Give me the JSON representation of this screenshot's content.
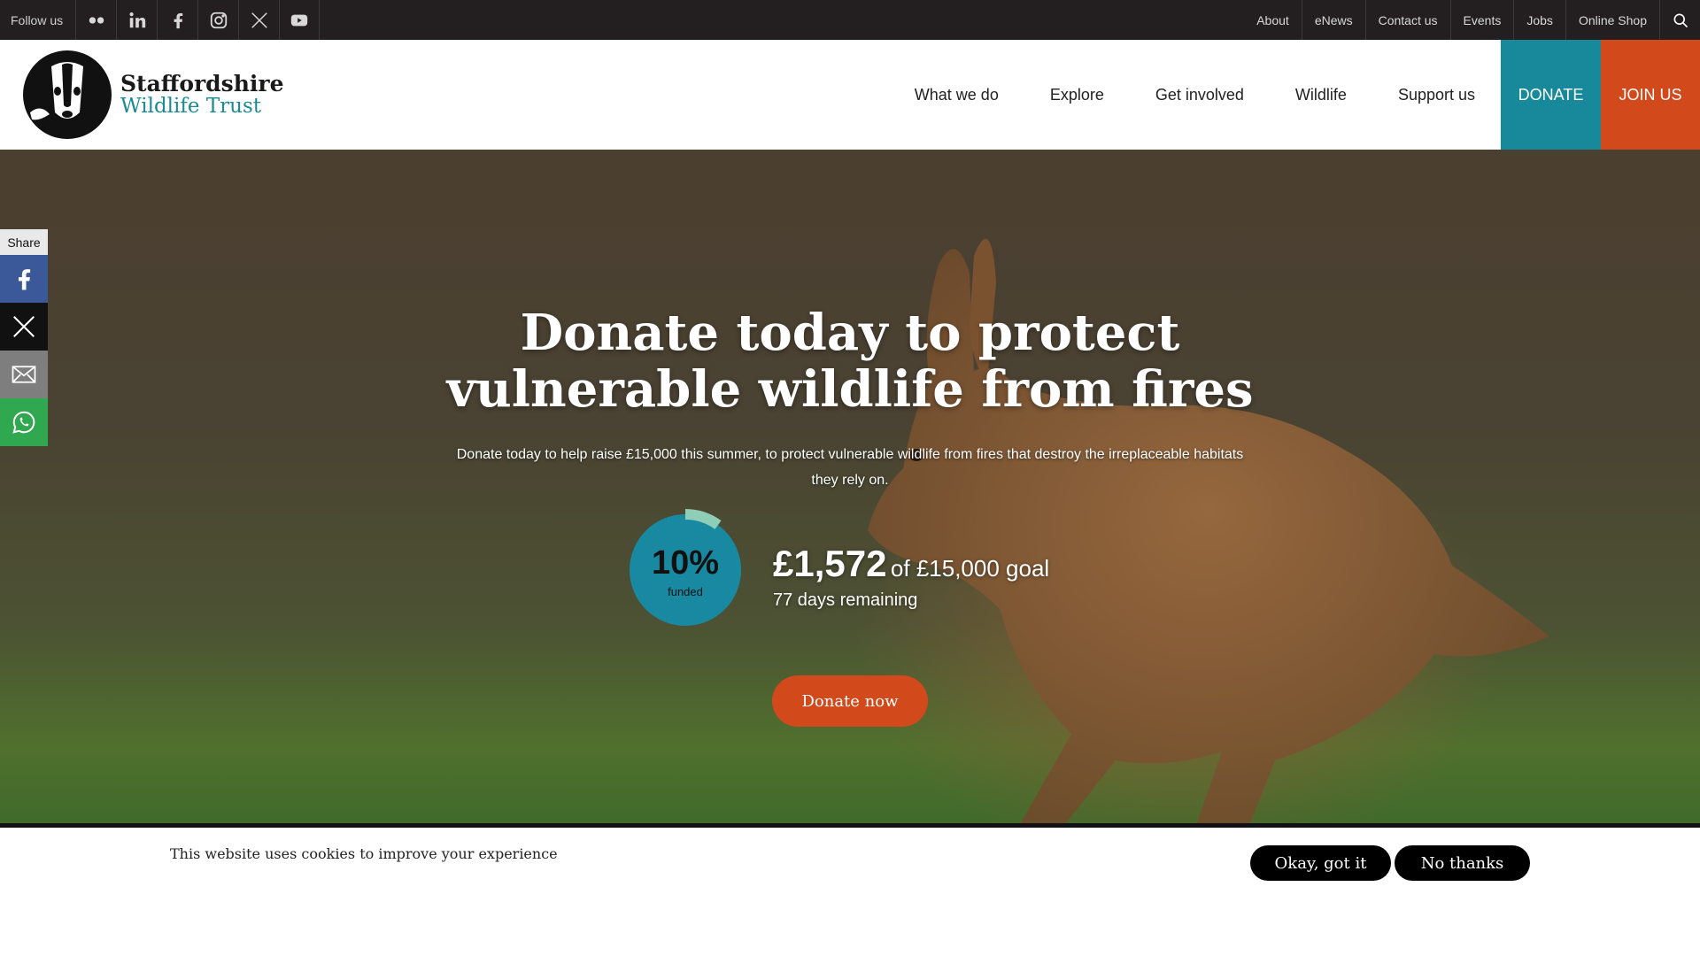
{
  "topbar": {
    "follow_label": "Follow us",
    "social_icons": [
      "flickr-icon",
      "linkedin-icon",
      "facebook-icon",
      "instagram-icon",
      "x-icon",
      "youtube-icon"
    ],
    "links": [
      "About",
      "eNews",
      "Contact us",
      "Events",
      "Jobs",
      "Online Shop"
    ]
  },
  "header": {
    "logo_line1": "Staffordshire",
    "logo_line2": "Wildlife Trust",
    "nav": [
      "What we do",
      "Explore",
      "Get involved",
      "Wildlife",
      "Support us"
    ],
    "donate": "DONATE",
    "join": "JOIN US"
  },
  "share": {
    "label": "Share"
  },
  "hero": {
    "title": "Donate today to protect vulnerable wildlife from fires",
    "subtitle": "Donate today to help raise £15,000 this summer, to protect vulnerable wildlife from fires that destroy the irreplaceable habitats they rely on.",
    "percent": "10%",
    "percent_value": 0.1,
    "funded_label": "funded",
    "raised": "£1,572",
    "goal": "of £15,000 goal",
    "days": "77 days remaining",
    "cta": "Donate now"
  },
  "cookie": {
    "text": "This website uses cookies to improve your experience",
    "ok": "Okay, got it",
    "no": "No thanks"
  },
  "colors": {
    "topbar": "#231f20",
    "teal": "#17899a",
    "orange": "#d24a1b",
    "progress_arc": "#8ecdb7"
  }
}
